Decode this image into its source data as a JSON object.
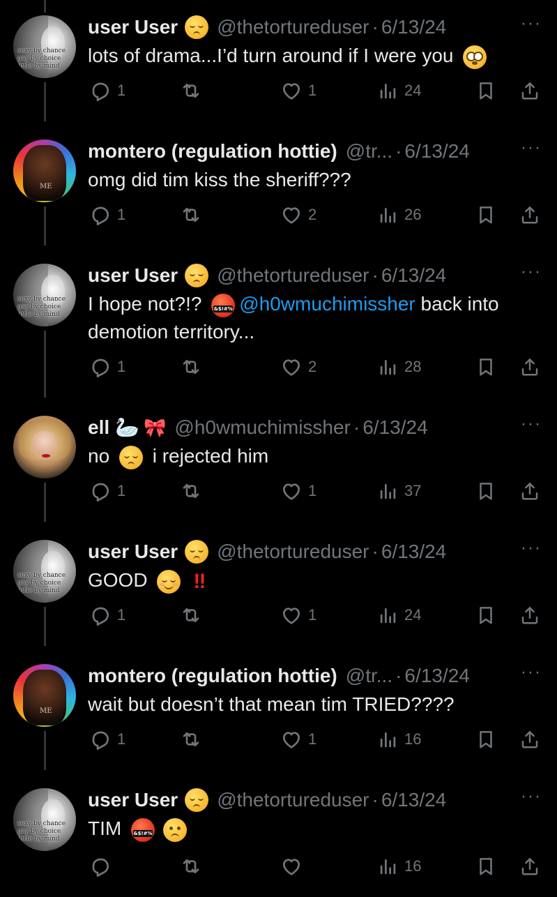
{
  "colors": {
    "background": "#000000",
    "text_primary": "#e7e9ea",
    "text_secondary": "#71767b",
    "mention": "#1d9bf0",
    "thread_line": "#333639"
  },
  "avatar_captions": {
    "user": "sexy by chance gay by choice little by mind"
  },
  "tweets": [
    {
      "avatar": "user",
      "name": "user User",
      "name_emoji": "relieved-face",
      "handle": "@thetortureduser",
      "date": "6/13/24",
      "segments": [
        {
          "type": "text",
          "value": "lots of drama...I’d turn around if I were you "
        },
        {
          "type": "emoji",
          "value": "flushed-face"
        }
      ],
      "replies": "1",
      "reposts": "",
      "likes": "1",
      "views": "24"
    },
    {
      "avatar": "montero",
      "name": "montero (regulation hottie)",
      "handle": "@tr...",
      "date": "6/13/24",
      "segments": [
        {
          "type": "text",
          "value": "omg did tim kiss the sheriff???"
        }
      ],
      "replies": "1",
      "reposts": "",
      "likes": "2",
      "views": "26"
    },
    {
      "avatar": "user",
      "name": "user User",
      "name_emoji": "relieved-face",
      "handle": "@thetortureduser",
      "date": "6/13/24",
      "segments": [
        {
          "type": "text",
          "value": "I hope not?!? "
        },
        {
          "type": "emoji",
          "value": "cursing-face"
        },
        {
          "type": "mention",
          "value": "@h0wmuchimissher"
        },
        {
          "type": "text",
          "value": " back into demotion territory..."
        }
      ],
      "replies": "1",
      "reposts": "",
      "likes": "2",
      "views": "28"
    },
    {
      "avatar": "ell",
      "name": "ell",
      "name_extras": [
        "swan",
        "ribbon"
      ],
      "handle": "@h0wmuchimissher",
      "date": "6/13/24",
      "segments": [
        {
          "type": "text",
          "value": "no "
        },
        {
          "type": "emoji",
          "value": "unamused-face"
        },
        {
          "type": "text",
          "value": " i rejected him"
        }
      ],
      "replies": "1",
      "reposts": "",
      "likes": "1",
      "views": "37"
    },
    {
      "avatar": "user",
      "name": "user User",
      "name_emoji": "relieved-face",
      "handle": "@thetortureduser",
      "date": "6/13/24",
      "segments": [
        {
          "type": "text",
          "value": "GOOD "
        },
        {
          "type": "emoji",
          "value": "smiling-face"
        },
        {
          "type": "bangs",
          "value": "‼"
        }
      ],
      "replies": "1",
      "reposts": "",
      "likes": "1",
      "views": "24"
    },
    {
      "avatar": "montero",
      "name": "montero (regulation hottie)",
      "handle": "@tr...",
      "date": "6/13/24",
      "segments": [
        {
          "type": "text",
          "value": "wait but doesn’t that mean tim TRIED????"
        }
      ],
      "replies": "1",
      "reposts": "",
      "likes": "1",
      "views": "16"
    },
    {
      "avatar": "user",
      "name": "user User",
      "name_emoji": "relieved-face",
      "handle": "@thetortureduser",
      "date": "6/13/24",
      "segments": [
        {
          "type": "text",
          "value": "TIM "
        },
        {
          "type": "emoji",
          "value": "cursing-face"
        },
        {
          "type": "emoji",
          "value": "frowning-face"
        }
      ],
      "replies": "",
      "reposts": "",
      "likes": "",
      "views": "16"
    }
  ],
  "icons": {
    "more": "more-icon",
    "reply": "reply-icon",
    "repost": "repost-icon",
    "like": "heart-icon",
    "views": "views-icon",
    "bookmark": "bookmark-icon",
    "share": "share-icon"
  },
  "cursing_symbol_text": "&$!#%"
}
